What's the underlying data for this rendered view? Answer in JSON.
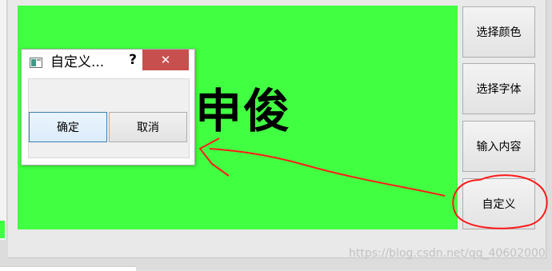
{
  "colors": {
    "canvas_bg": "#41ff41",
    "annotation": "#ff1a1a",
    "close_button": "#c7504f"
  },
  "canvas": {
    "text": "申俊"
  },
  "side_buttons": [
    {
      "label": "选择颜色"
    },
    {
      "label": "选择字体"
    },
    {
      "label": "输入内容"
    },
    {
      "label": "自定义"
    }
  ],
  "dialog": {
    "title": "自定义...",
    "help": "?",
    "close": "✕",
    "ok_label": "确定",
    "cancel_label": "取消"
  },
  "watermark": "https://blog.csdn.net/qq_40602000"
}
